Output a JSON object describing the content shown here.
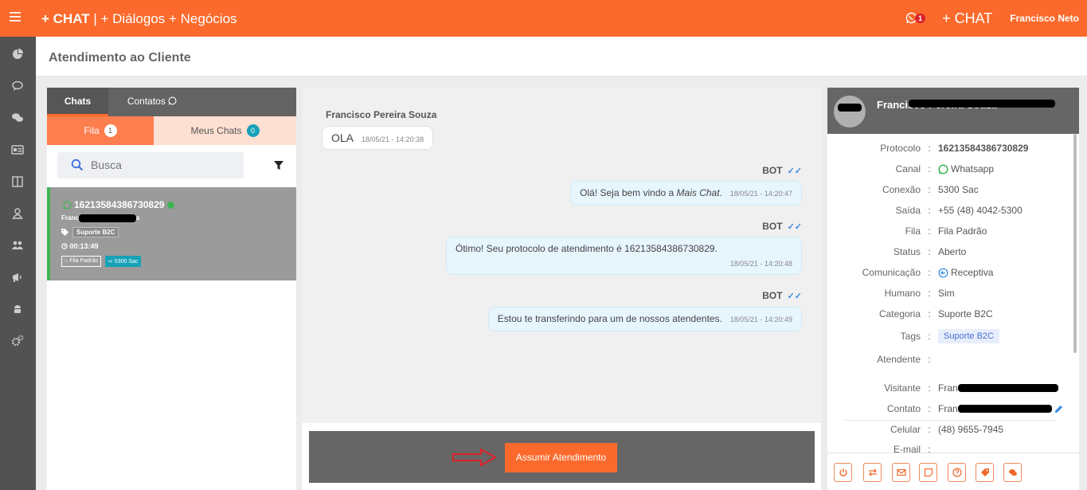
{
  "topbar": {
    "brand_bold": "+ CHAT",
    "brand_rest": " | + Diálogos + Negócios",
    "whatsapp_count": "1",
    "chat_label": "+ CHAT",
    "user_name": "Francisco Neto",
    "color": "#fb6a2c"
  },
  "sidebar": {
    "icons": [
      "pie-chart-icon",
      "chat-bubble-icon",
      "chats-icon",
      "id-card-icon",
      "columns-icon",
      "user-icon",
      "users-icon",
      "megaphone-icon",
      "android-icon",
      "gears-icon"
    ]
  },
  "page": {
    "title": "Atendimento ao Cliente"
  },
  "chat_list": {
    "tab_chats": "Chats",
    "tab_contatos": "Contatos",
    "tab_fila": "Fila",
    "fila_count": "1",
    "tab_meus": "Meus Chats",
    "meus_count": "0",
    "search_placeholder": "Busca",
    "items": [
      {
        "protocol": "16213584386730829",
        "name_start": "Franc",
        "name_end": "a",
        "tag": "Suporte B2C",
        "time": "00:13:49",
        "queue": "Fila Padrão",
        "connection": "5300 Sac"
      }
    ]
  },
  "conversation": {
    "visitor_name": "Francisco Pereira Souza",
    "messages": [
      {
        "from": "visitor",
        "text": "OLA",
        "time": "18/05/21 - 14:20:38"
      },
      {
        "from": "BOT",
        "text_before": "Olá! Seja bem vindo a ",
        "text_italic": "Mais Chat",
        "text_after": ".",
        "time": "18/05/21 - 14:20:47"
      },
      {
        "from": "BOT",
        "text": "Ótimo! Seu protocolo de atendimento é 16213584386730829.",
        "time": "18/05/21 - 14:20:48"
      },
      {
        "from": "BOT",
        "text": "Estou te transferindo para um de nossos atendentes.",
        "time": "18/05/21 - 14:20:49"
      }
    ],
    "assumir_label": "Assumir Atendimento"
  },
  "details": {
    "name": "Francisco Pereira Souza",
    "fields": {
      "protocolo": {
        "label": "Protocolo",
        "value": "16213584386730829"
      },
      "canal": {
        "label": "Canal",
        "value": "Whatsapp"
      },
      "conexao": {
        "label": "Conexão",
        "value": "5300 Sac"
      },
      "saida": {
        "label": "Saída",
        "value": "+55 (48) 4042-5300"
      },
      "fila": {
        "label": "Fila",
        "value": "Fila Padrão"
      },
      "status": {
        "label": "Status",
        "value": "Aberto"
      },
      "comunicacao": {
        "label": "Comunicação",
        "value": "Receptiva"
      },
      "humano": {
        "label": "Humano",
        "value": "Sim"
      },
      "categoria": {
        "label": "Categoria",
        "value": "Suporte B2C"
      },
      "tags": {
        "label": "Tags",
        "value": "Suporte B2C"
      },
      "atendente": {
        "label": "Atendente",
        "value": ""
      },
      "visitante": {
        "label": "Visitante",
        "value": "Fran"
      },
      "contato": {
        "label": "Contato",
        "value": "Fran"
      },
      "celular": {
        "label": "Celular",
        "value": "(48) 9655-7945"
      },
      "email": {
        "label": "E-mail",
        "value": ""
      }
    },
    "footer_icons": [
      "power-icon",
      "transfer-icon",
      "email-icon",
      "note-icon",
      "help-icon",
      "tag-icon",
      "comments-icon"
    ]
  }
}
